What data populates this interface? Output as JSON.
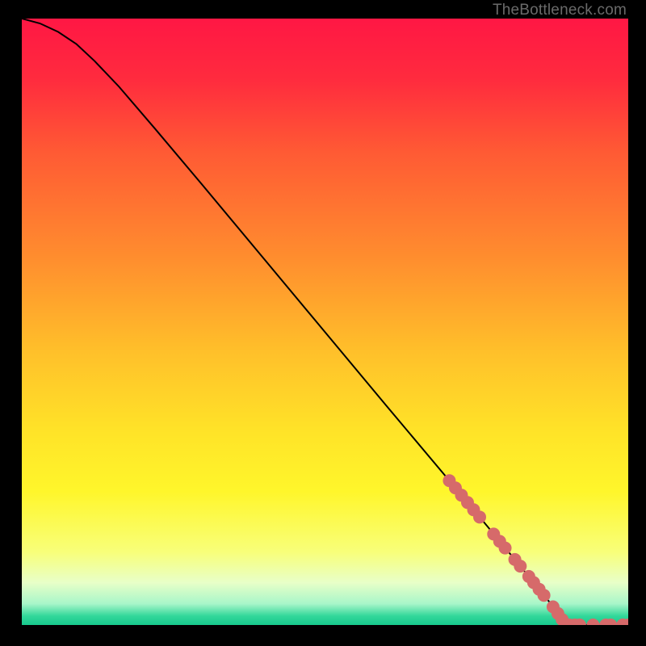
{
  "attribution": "TheBottleneck.com",
  "chart_data": {
    "type": "line",
    "title": "",
    "xlabel": "",
    "ylabel": "",
    "xlim": [
      0,
      100
    ],
    "ylim": [
      0,
      100
    ],
    "background": {
      "type": "vertical-gradient",
      "stops": [
        {
          "pos": 0.0,
          "color": "#ff1744"
        },
        {
          "pos": 0.1,
          "color": "#ff2b3e"
        },
        {
          "pos": 0.22,
          "color": "#ff5a34"
        },
        {
          "pos": 0.4,
          "color": "#ff8f2e"
        },
        {
          "pos": 0.55,
          "color": "#ffc02a"
        },
        {
          "pos": 0.68,
          "color": "#ffe328"
        },
        {
          "pos": 0.78,
          "color": "#fff62b"
        },
        {
          "pos": 0.88,
          "color": "#f8ff7a"
        },
        {
          "pos": 0.93,
          "color": "#e8ffc8"
        },
        {
          "pos": 0.965,
          "color": "#a8f6c9"
        },
        {
          "pos": 0.985,
          "color": "#33d79a"
        },
        {
          "pos": 1.0,
          "color": "#17c98d"
        }
      ]
    },
    "series": [
      {
        "name": "curve",
        "stroke": "#000000",
        "points": [
          {
            "x": 0.0,
            "y": 100.0
          },
          {
            "x": 3.0,
            "y": 99.2
          },
          {
            "x": 6.0,
            "y": 97.8
          },
          {
            "x": 9.0,
            "y": 95.8
          },
          {
            "x": 12.0,
            "y": 93.0
          },
          {
            "x": 16.0,
            "y": 88.8
          },
          {
            "x": 22.0,
            "y": 81.8
          },
          {
            "x": 30.0,
            "y": 72.3
          },
          {
            "x": 40.0,
            "y": 60.3
          },
          {
            "x": 50.0,
            "y": 48.3
          },
          {
            "x": 60.0,
            "y": 36.3
          },
          {
            "x": 70.0,
            "y": 24.4
          },
          {
            "x": 78.0,
            "y": 14.8
          },
          {
            "x": 84.0,
            "y": 7.5
          },
          {
            "x": 87.0,
            "y": 3.8
          },
          {
            "x": 88.5,
            "y": 1.8
          },
          {
            "x": 89.3,
            "y": 0.6
          },
          {
            "x": 89.8,
            "y": 0.15
          },
          {
            "x": 90.3,
            "y": 0.0
          },
          {
            "x": 100.0,
            "y": 0.0
          }
        ]
      }
    ],
    "markers": {
      "name": "highlight-dots",
      "color": "#d66a6a",
      "radius_px": 8,
      "points": [
        {
          "x": 70.5,
          "y": 23.8
        },
        {
          "x": 71.5,
          "y": 22.6
        },
        {
          "x": 72.5,
          "y": 21.4
        },
        {
          "x": 73.5,
          "y": 20.2
        },
        {
          "x": 74.5,
          "y": 19.0
        },
        {
          "x": 75.5,
          "y": 17.8
        },
        {
          "x": 77.8,
          "y": 15.0
        },
        {
          "x": 78.8,
          "y": 13.8
        },
        {
          "x": 79.7,
          "y": 12.7
        },
        {
          "x": 81.3,
          "y": 10.8
        },
        {
          "x": 82.2,
          "y": 9.7
        },
        {
          "x": 83.6,
          "y": 8.0
        },
        {
          "x": 84.4,
          "y": 7.0
        },
        {
          "x": 85.3,
          "y": 5.9
        },
        {
          "x": 86.1,
          "y": 4.9
        },
        {
          "x": 87.6,
          "y": 3.0
        },
        {
          "x": 88.4,
          "y": 1.9
        },
        {
          "x": 89.1,
          "y": 0.9
        },
        {
          "x": 90.3,
          "y": 0.0
        },
        {
          "x": 91.2,
          "y": 0.0
        },
        {
          "x": 92.0,
          "y": 0.0
        },
        {
          "x": 94.2,
          "y": 0.0
        },
        {
          "x": 96.3,
          "y": 0.0
        },
        {
          "x": 97.1,
          "y": 0.0
        },
        {
          "x": 99.1,
          "y": 0.0
        },
        {
          "x": 100.0,
          "y": 0.0
        }
      ]
    }
  }
}
